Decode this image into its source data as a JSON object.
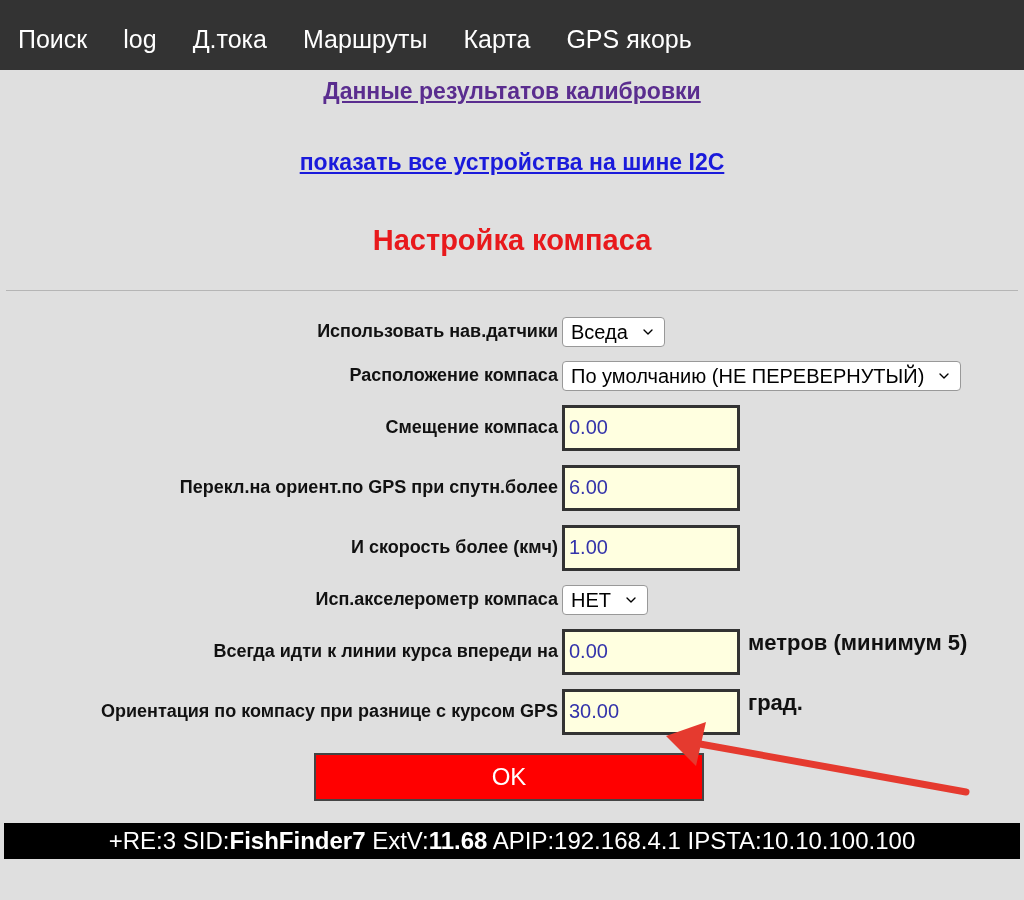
{
  "nav": {
    "items": [
      {
        "label": "Поиск"
      },
      {
        "label": "log"
      },
      {
        "label": "Д.тока"
      },
      {
        "label": "Маршруты"
      },
      {
        "label": "Карта"
      },
      {
        "label": "GPS якорь"
      }
    ]
  },
  "links": [
    {
      "label": "Данные результатов калибровки",
      "visited": true
    },
    {
      "label": "показать все устройства на шине I2C",
      "visited": false
    }
  ],
  "heading": "Настройка компаса",
  "form": {
    "rows": [
      {
        "kind": "select",
        "label": "Использовать нав.датчики",
        "value": "Вседа"
      },
      {
        "kind": "select",
        "label": "Расположение компаса",
        "value": "По умолчанию (НЕ ПЕРЕВЕРНУТЫЙ)"
      },
      {
        "kind": "input",
        "label": "Смещение компаса",
        "value": "0.00"
      },
      {
        "kind": "input",
        "label": "Перекл.на ориент.по GPS при спутн.более",
        "value": "6.00"
      },
      {
        "kind": "input",
        "label": "И скорость более (кмч)",
        "value": "1.00"
      },
      {
        "kind": "select",
        "label": "Исп.акселерометр компаса",
        "value": "НЕТ"
      },
      {
        "kind": "input",
        "label": "Всегда идти к линии курса впереди на",
        "value": "0.00",
        "suffix": "метров (минимум 5)"
      },
      {
        "kind": "input",
        "label": "Ориентация по компасу при разнице с курсом GPS",
        "value": "30.00",
        "suffix": "град."
      }
    ],
    "submit": "OK"
  },
  "status_bar": "+RE:3 SID:**FishFinder7** ExtV:**11.68** APIP:192.168.4.1 IPSTA:10.10.100.100"
}
